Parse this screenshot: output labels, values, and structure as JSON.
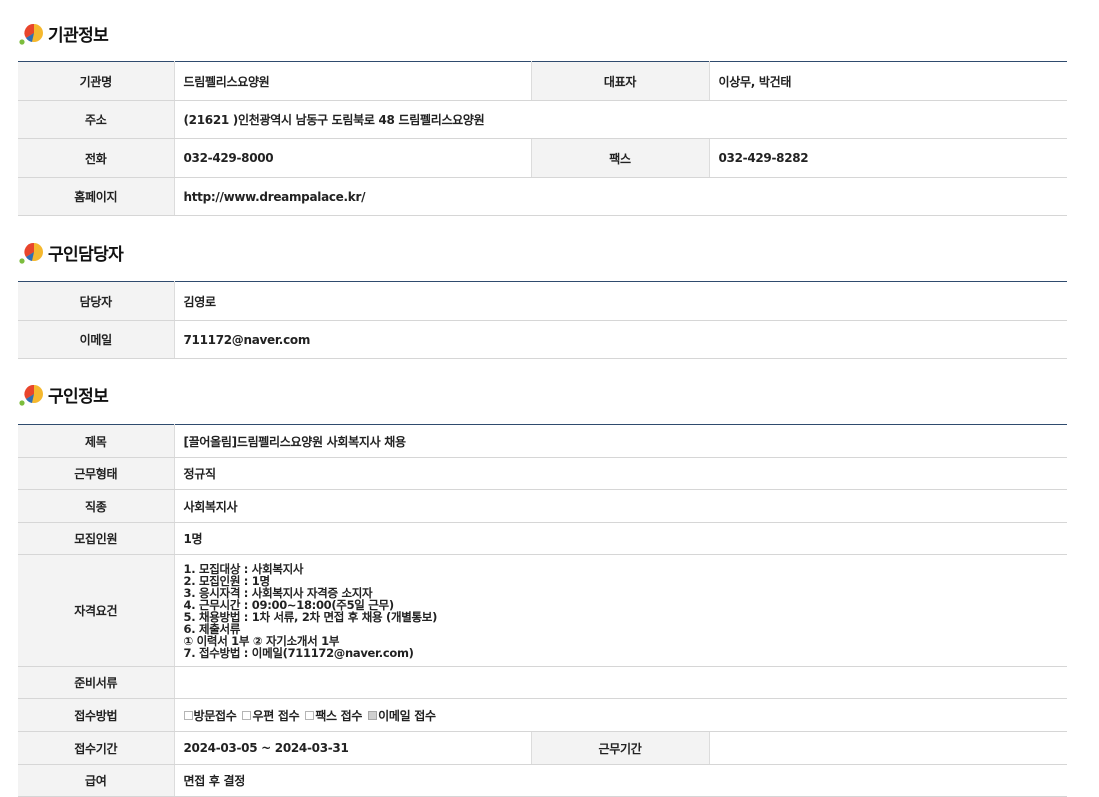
{
  "sections": {
    "org_title": "기관정보",
    "contact_title": "구인담당자",
    "job_title": "구인정보"
  },
  "org": {
    "name_label": "기관명",
    "name": "드림펠리스요양원",
    "rep_label": "대표자",
    "rep": "이상무, 박건태",
    "addr_label": "주소",
    "addr": "(21621 )인천광역시 남동구 도림북로 48 드림펠리스요양원",
    "tel_label": "전화",
    "tel": "032-429-8000",
    "fax_label": "팩스",
    "fax": "032-429-8282",
    "home_label": "홈페이지",
    "home": "http://www.dreampalace.kr/"
  },
  "contact": {
    "person_label": "담당자",
    "person": "김영로",
    "email_label": "이메일",
    "email": "711172@naver.com"
  },
  "job": {
    "subject_label": "제목",
    "subject": "[끌어올림]드림펠리스요양원 사회복지사 채용",
    "type_label": "근무형태",
    "type": "정규직",
    "occupation_label": "직종",
    "occupation": "사회복지사",
    "count_label": "모집인원",
    "count": "1명",
    "req_label": "자격요건",
    "requirements": [
      "1. 모집대상 : 사회복지사",
      "2. 모집인원 : 1명",
      "3. 응시자격 : 사회복지사 자격증 소지자",
      "4. 근무시간 : 09:00~18:00(주5일 근무)",
      "5. 채용방법 : 1차 서류, 2차 면접 후 채용 (개별통보)",
      "6. 제출서류",
      " ① 이력서 1부  ② 자기소개서 1부",
      "7. 접수방법 : 이메일(711172@naver.com)"
    ],
    "docs_label": "준비서류",
    "docs": "",
    "method_label": "접수방법",
    "methods": [
      {
        "label": "방문접수",
        "checked": false
      },
      {
        "label": "우편 접수",
        "checked": false
      },
      {
        "label": "팩스 접수",
        "checked": false
      },
      {
        "label": "이메일 접수",
        "checked": true
      }
    ],
    "period_label": "접수기간",
    "period": "2024-03-05 ~ 2024-03-31",
    "work_period_label": "근무기간",
    "work_period": "",
    "salary_label": "급여",
    "salary": "면접 후 결정"
  }
}
